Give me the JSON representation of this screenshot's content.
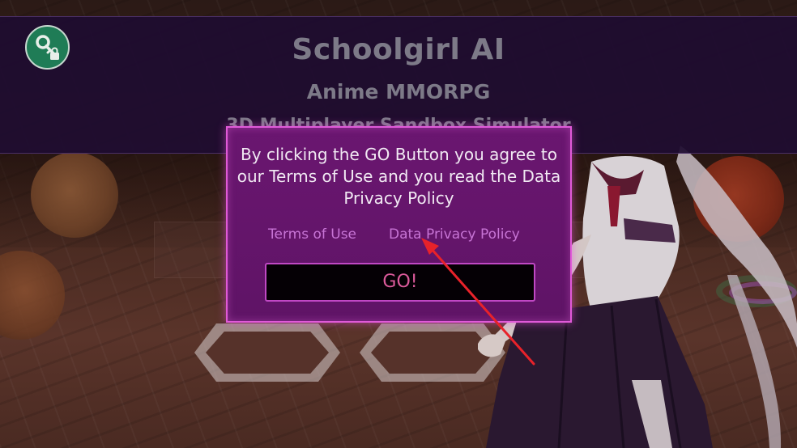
{
  "banner": {
    "title": "Schoolgirl AI",
    "subtitle": "Anime MMORPG",
    "tagline": "3D Multiplayer Sandbox Simulator"
  },
  "icons": {
    "account": "key-lock-icon"
  },
  "modal": {
    "message": "By clicking the GO Button you agree to our Terms of Use and you read the Data Privacy Policy",
    "terms_link": "Terms of Use",
    "privacy_link": "Data Privacy Policy",
    "go_label": "GO!"
  },
  "colors": {
    "modal_bg": "#621468",
    "modal_border": "#e05ad8",
    "link": "#c774d5",
    "go_text": "#dc5a9b",
    "banner_bg": "#1e0c30",
    "key_button": "#1f7c56",
    "arrow": "#e8222a"
  }
}
